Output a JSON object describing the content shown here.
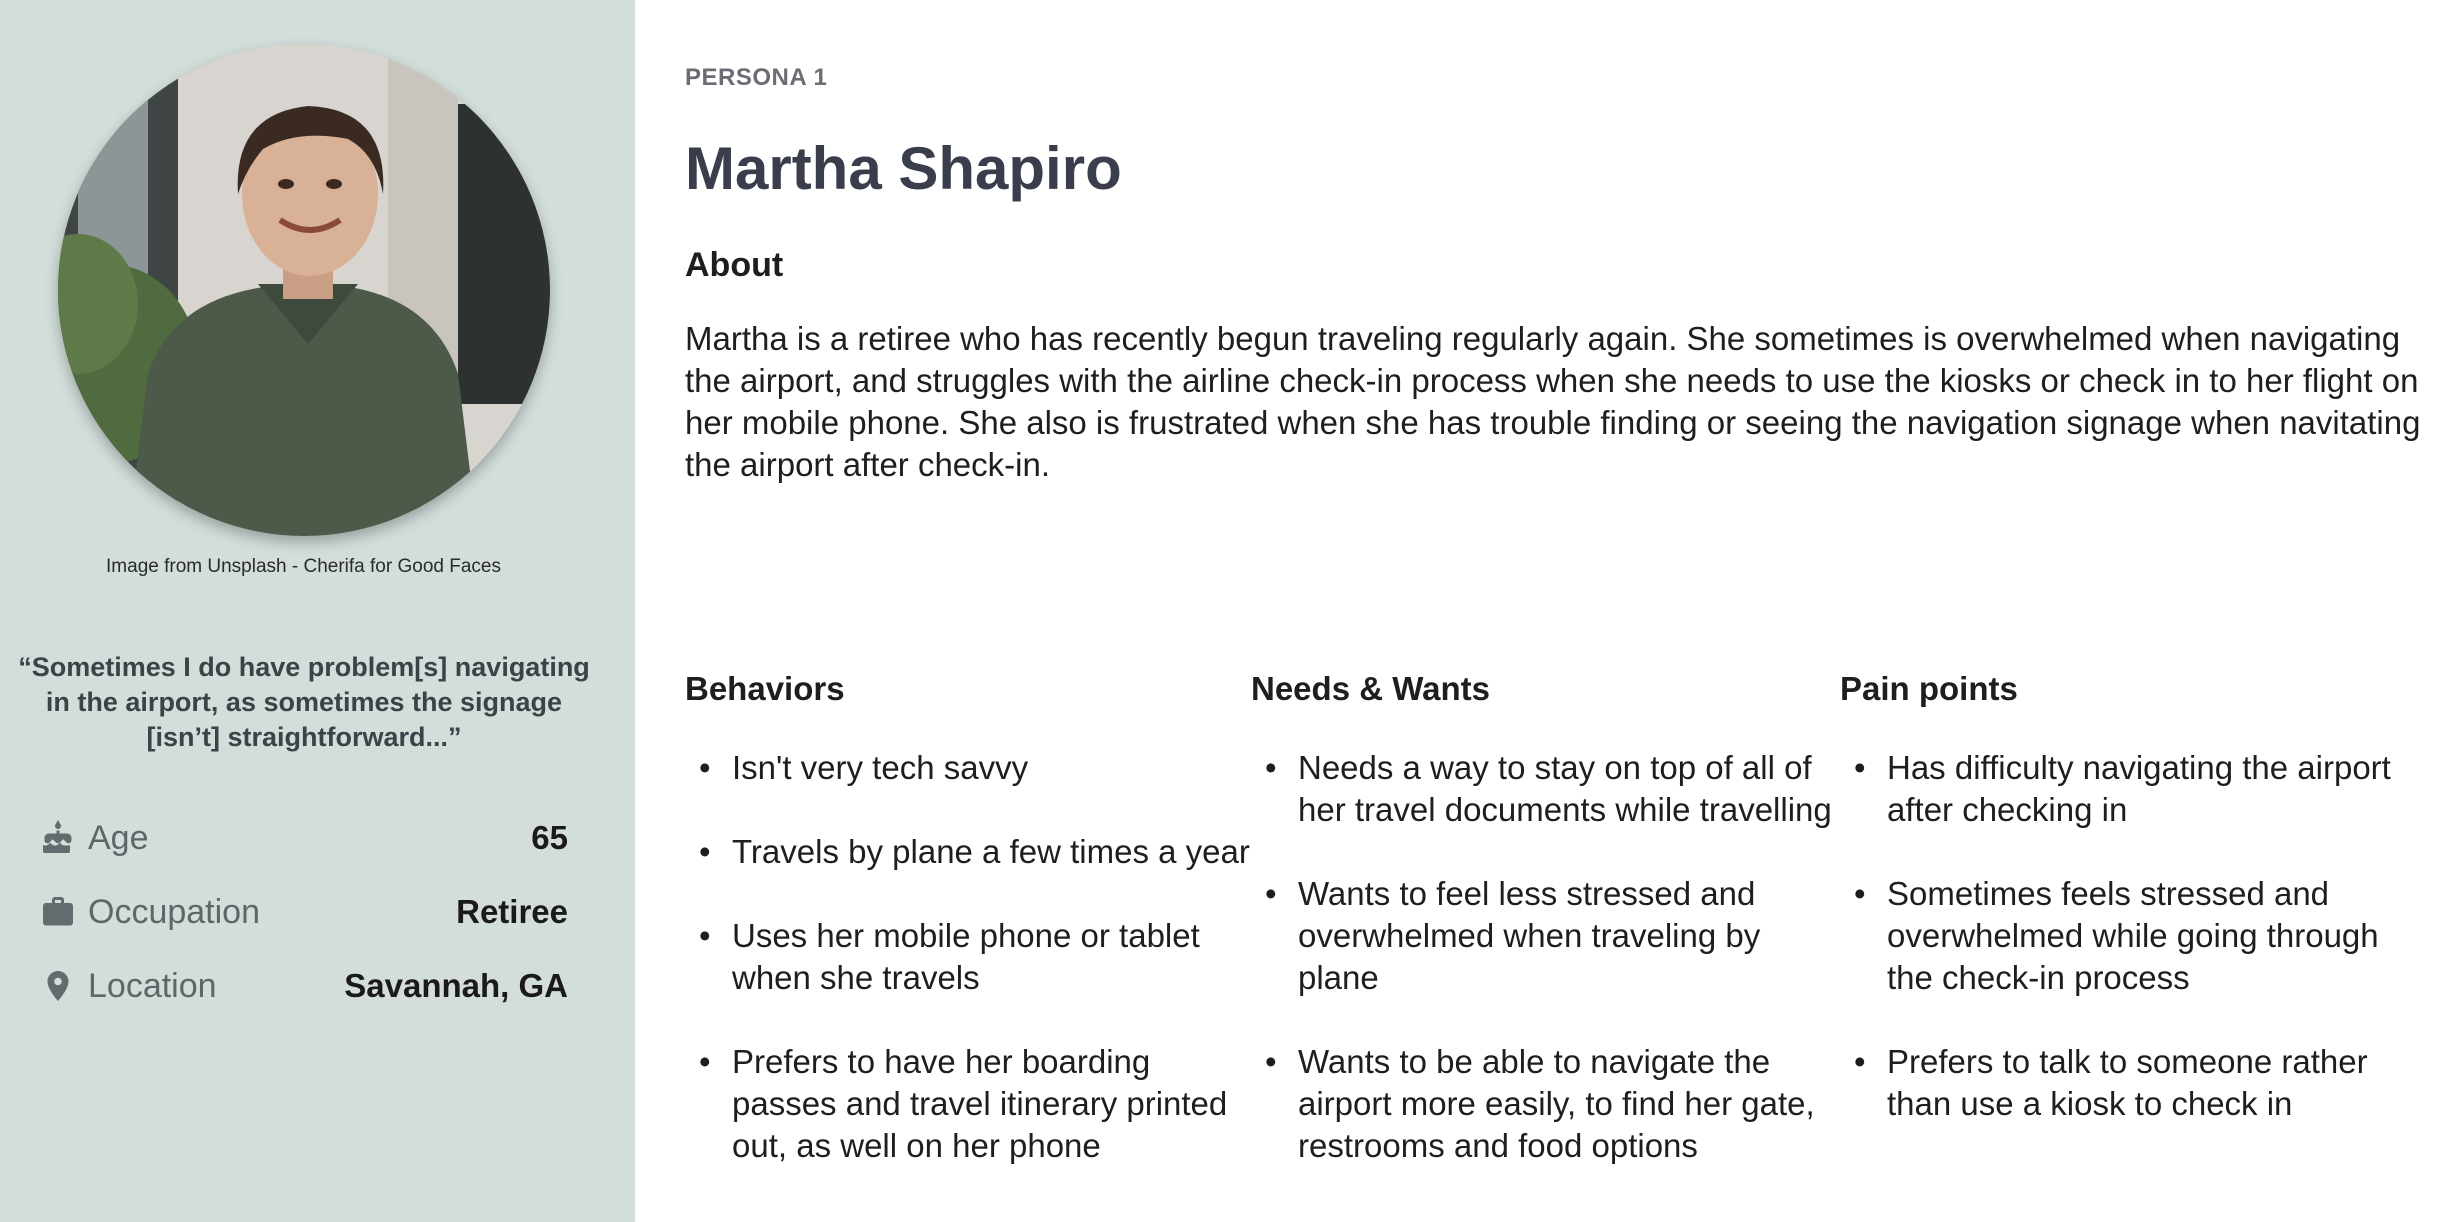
{
  "sidebar": {
    "photo_credit": "Image from Unsplash - Cherifa for Good Faces",
    "quote": "“Sometimes I do have problem[s] navigating in the airport, as sometimes the signage [isn’t] straightforward...”",
    "stats": [
      {
        "icon": "cake-icon",
        "label": "Age",
        "value": "65"
      },
      {
        "icon": "briefcase-icon",
        "label": "Occupation",
        "value": "Retiree"
      },
      {
        "icon": "location-pin-icon",
        "label": "Location",
        "value": "Savannah, GA"
      }
    ],
    "background_color": "#d3dedb"
  },
  "persona": {
    "eyebrow": "PERSONA 1",
    "name": "Martha Shapiro",
    "about_heading": "About",
    "about_text": "Martha is a retiree who has recently begun traveling regularly again. She sometimes is overwhelmed when navigating the airport, and  struggles with the airline check-in process when she needs to use the kiosks or check in to her flight on her mobile phone. She also is frustrated when she has trouble finding or seeing the navigation signage when navitating the airport after check-in."
  },
  "sections": {
    "behaviors": {
      "title": "Behaviors",
      "items": [
        "Isn't very tech savvy",
        "Travels by plane a few times a year",
        "Uses her mobile phone or tablet when she travels",
        "Prefers to have her boarding passes and travel itinerary printed out, as well on her phone"
      ]
    },
    "needs": {
      "title": "Needs & Wants",
      "items": [
        "Needs a way to stay on top of all of her travel documents while travelling",
        "Wants to feel less stressed and overwhelmed when traveling by plane",
        "Wants to be able to navigate the airport more easily, to find her gate, restrooms and food options"
      ]
    },
    "pain_points": {
      "title": "Pain points",
      "items": [
        "Has difficulty navigating the airport after checking in",
        "Sometimes feels stressed and overwhelmed while going through the check-in process",
        "Prefers to talk to someone rather than use a kiosk to check in"
      ]
    }
  }
}
